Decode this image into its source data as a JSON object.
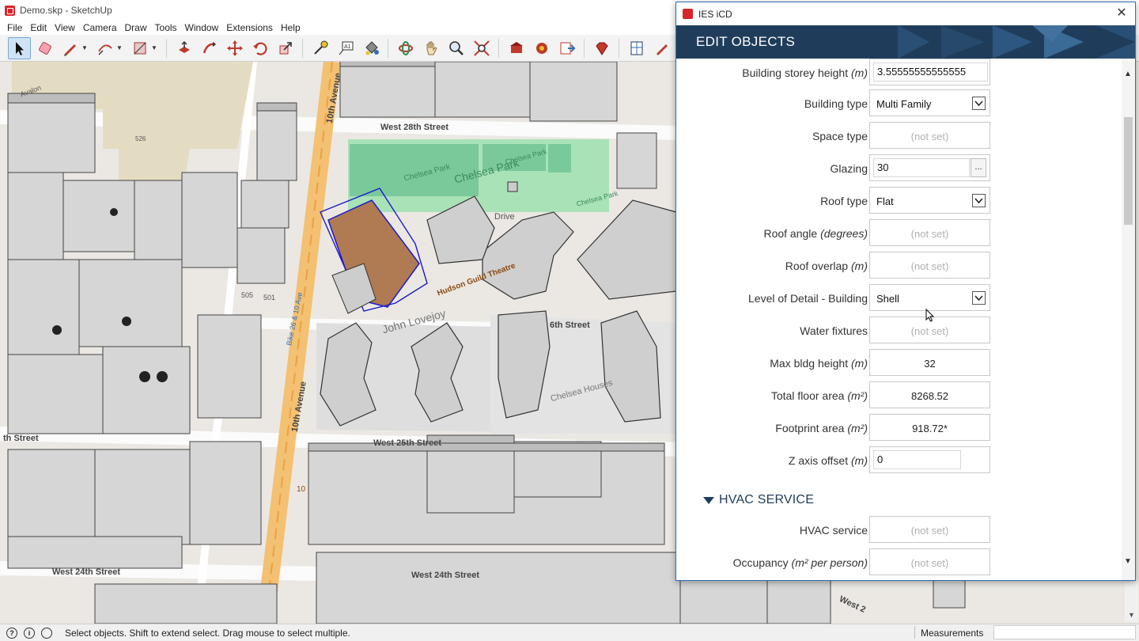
{
  "window": {
    "title": "Demo.skp - SketchUp"
  },
  "menubar": [
    "File",
    "Edit",
    "View",
    "Camera",
    "Draw",
    "Tools",
    "Window",
    "Extensions",
    "Help"
  ],
  "toolbar": {
    "tools": [
      "select-tool",
      "eraser-tool",
      "pencil-tool",
      "arc-tool",
      "rectangle-tool",
      "push-pull-tool",
      "follow-me-tool",
      "move-tool",
      "rotate-tool",
      "scale-tool",
      "tape-measure-tool",
      "text-tool",
      "paint-bucket-tool",
      "orbit-tool",
      "pan-tool",
      "zoom-tool",
      "zoom-extents-tool",
      "warehouse-tool",
      "extension-warehouse-tool",
      "send-to-layout-tool",
      "ruby-console-tool",
      "ies-model-tool",
      "ies-draw-tool",
      "ies-extra-tool"
    ]
  },
  "map_labels": {
    "west_28th": "West 28th Street",
    "west_25th": "West 25th Street",
    "west_24th_left": "West 24th Street",
    "west_24th_mid": "West 24th Street",
    "tenth_ave_top": "10th Avenue",
    "tenth_ave_bottom": "10th Avenue",
    "chelsea_park": "Chelsea Park",
    "chelsea_park_small": "Chelsea Park",
    "chelsea_park_small2": "Chelsea Park",
    "chelsea_park_small3": "Chelsea Park",
    "hudson_guild": "Hudson Guild Theatre",
    "john_lovejoy": "John Lovejoy",
    "chelsea_houses": "Chelsea Houses",
    "drive": "Drive",
    "sixth_street": "6th Street",
    "th_street": "th Street",
    "west_2": "West 2",
    "bike": "Bike 26 & 10 Ave",
    "n505": "505",
    "n501": "501",
    "avalon": "Avalon",
    "n526": "526",
    "n10": "10"
  },
  "dialog": {
    "title": "IES iCD",
    "header": "EDIT OBJECTS",
    "close": "✕",
    "fields": [
      {
        "label": "Building storey height ",
        "unit": "(m)",
        "value": "3.55555555555555",
        "kind": "input"
      },
      {
        "label": "Building type",
        "unit": "",
        "value": "Multi Family",
        "kind": "dropdown"
      },
      {
        "label": "Space type",
        "unit": "",
        "value": "(not set)",
        "kind": "unset"
      },
      {
        "label": "Glazing",
        "unit": "",
        "value": "30",
        "kind": "input-ellipsis"
      },
      {
        "label": "Roof type",
        "unit": "",
        "value": "Flat",
        "kind": "dropdown"
      },
      {
        "label": "Roof angle ",
        "unit": "(degrees)",
        "value": "(not set)",
        "kind": "unset"
      },
      {
        "label": "Roof overlap ",
        "unit": "(m)",
        "value": "(not set)",
        "kind": "unset"
      },
      {
        "label": "Level of Detail - Building",
        "unit": "",
        "value": "Shell",
        "kind": "dropdown"
      },
      {
        "label": "Water fixtures",
        "unit": "",
        "value": "(not set)",
        "kind": "unset"
      },
      {
        "label": "Max bldg height ",
        "unit": "(m)",
        "value": "32",
        "kind": "value"
      },
      {
        "label": "Total floor area ",
        "unit": "(m²)",
        "value": "8268.52",
        "kind": "value"
      },
      {
        "label": "Footprint area ",
        "unit": "(m²)",
        "value": "918.72*",
        "kind": "value"
      },
      {
        "label": "Z axis offset ",
        "unit": "(m)",
        "value": "0",
        "kind": "input"
      }
    ],
    "hvac_section": "HVAC SERVICE",
    "hvac_fields": [
      {
        "label": "HVAC service",
        "unit": "",
        "value": "(not set)",
        "kind": "unset"
      },
      {
        "label": "Occupancy ",
        "unit": "(m² per person)",
        "value": "(not set)",
        "kind": "unset"
      }
    ],
    "ellipsis": "...",
    "colors": {
      "header_bg": "#1f3d5b",
      "accent": "#2f6fb4"
    }
  },
  "statusbar": {
    "text": "Select objects. Shift to extend select. Drag mouse to select multiple.",
    "measurements_label": "Measurements",
    "icon_info": "i",
    "icon_help": "?"
  }
}
